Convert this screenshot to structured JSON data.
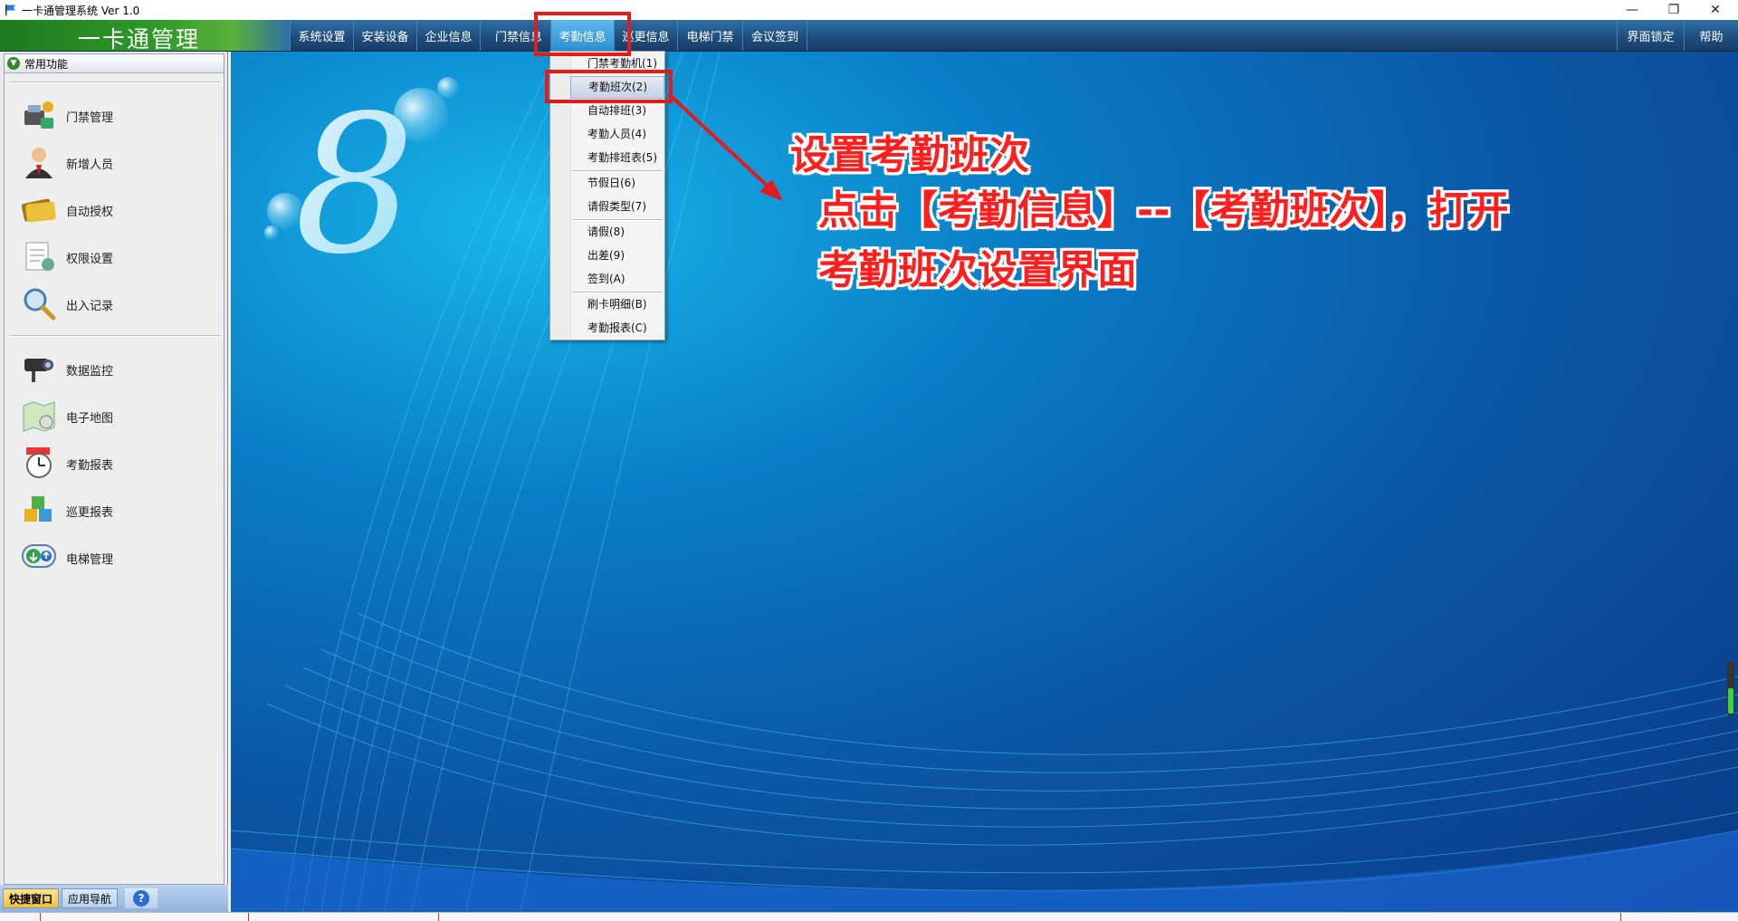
{
  "window": {
    "title": "一卡通管理系统  Ver 1.0",
    "controls": {
      "minimize": "—",
      "restore": "❐",
      "close": "✕"
    }
  },
  "app": {
    "logo_text": "一卡通管理"
  },
  "menubar": {
    "items": [
      "系统设置",
      "安装设备",
      "企业信息",
      "门禁信息",
      "考勤信息",
      "巡更信息",
      "电梯门禁",
      "会议签到"
    ],
    "active": "考勤信息",
    "right_items": [
      "界面锁定",
      "帮助"
    ]
  },
  "sidebar": {
    "header": "常用功能",
    "group1": [
      "门禁管理",
      "新增人员",
      "自动授权",
      "权限设置",
      "出入记录"
    ],
    "group2": [
      "数据监控",
      "电子地图",
      "考勤报表",
      "巡更报表",
      "电梯管理"
    ],
    "tabs": {
      "quick": "快捷窗口",
      "nav": "应用导航",
      "help": "?"
    }
  },
  "dropdown": {
    "items": [
      {
        "label": "门禁考勤机(1)"
      },
      {
        "label": "考勤班次(2)",
        "highlighted": true
      },
      {
        "label": "自动排班(3)"
      },
      {
        "label": "考勤人员(4)"
      },
      {
        "label": "考勤排班表(5)"
      },
      {
        "label": "节假日(6)"
      },
      {
        "label": "请假类型(7)"
      },
      {
        "label": "请假(8)"
      },
      {
        "label": "出差(9)"
      },
      {
        "label": "签到(A)"
      },
      {
        "label": "刷卡明细(B)"
      },
      {
        "label": "考勤报表(C)"
      }
    ]
  },
  "annotation": {
    "heading": "设置考勤班次",
    "line1": "点击【考勤信息】--【考勤班次】，打开",
    "line2": "考勤班次设置界面"
  },
  "colors": {
    "annotation": "#ff1f1f",
    "highlight_box": "#e11c1c",
    "menubar": "#1f4f80",
    "logo_green": "#2f9a2a"
  }
}
